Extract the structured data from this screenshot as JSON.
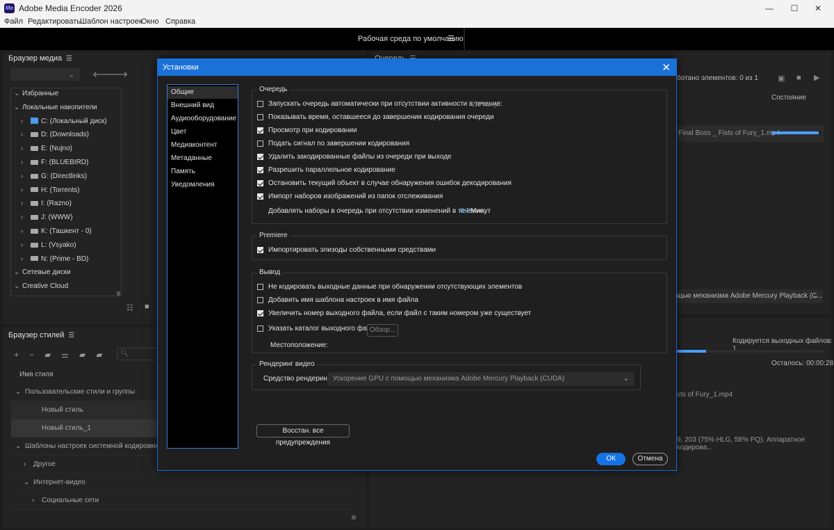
{
  "window": {
    "title": "Adobe Media Encoder 2026",
    "app_icon": "Me",
    "controls": [
      "—",
      "☐",
      "✕"
    ]
  },
  "menu": [
    "Файл",
    "Редактировать",
    "Шаблон настроек",
    "Окно",
    "Справка"
  ],
  "workspace": {
    "label": "Рабочая среда по умолчанию",
    "menu_icon": "☰"
  },
  "media_browser": {
    "title": "Браузер медиа",
    "tree": [
      {
        "label": "Избранные",
        "level": 0,
        "expanded": true,
        "drive": "none"
      },
      {
        "label": "Локальные накопители",
        "level": 0,
        "expanded": true,
        "drive": "none"
      },
      {
        "label": "C: (Локальный диск)",
        "level": 1,
        "expanded": false,
        "drive": "system"
      },
      {
        "label": "D: (Downloads)",
        "level": 1,
        "expanded": false,
        "drive": "disk"
      },
      {
        "label": "E: (Nujno)",
        "level": 1,
        "expanded": false,
        "drive": "disk"
      },
      {
        "label": "F: (BLUEBIRD)",
        "level": 1,
        "expanded": false,
        "drive": "disk"
      },
      {
        "label": "G: (Directlinks)",
        "level": 1,
        "expanded": false,
        "drive": "disk"
      },
      {
        "label": "H: (Torrents)",
        "level": 1,
        "expanded": false,
        "drive": "disk"
      },
      {
        "label": "I: (Razno)",
        "level": 1,
        "expanded": false,
        "drive": "disk"
      },
      {
        "label": "J: (WWW)",
        "level": 1,
        "expanded": false,
        "drive": "disk"
      },
      {
        "label": "K: (Ташкент - 0)",
        "level": 1,
        "expanded": false,
        "drive": "disk"
      },
      {
        "label": "L: (Vsyako)",
        "level": 1,
        "expanded": false,
        "drive": "disk"
      },
      {
        "label": "N: (Prime - BD)",
        "level": 1,
        "expanded": false,
        "drive": "disk"
      },
      {
        "label": "Сетевые диски",
        "level": 0,
        "expanded": true,
        "drive": "none"
      },
      {
        "label": "Creative Cloud",
        "level": 0,
        "expanded": true,
        "drive": "none"
      }
    ]
  },
  "style_browser": {
    "title": "Браузер стилей",
    "column": "Имя стиля",
    "rows": [
      {
        "label": "Пользовательские стили и группы",
        "indent": 0,
        "arrow": "⌄",
        "state": ""
      },
      {
        "label": "Новый стиль",
        "indent": 2,
        "arrow": "",
        "state": "dim"
      },
      {
        "label": "Новый стиль_1",
        "indent": 2,
        "arrow": "",
        "state": "sel"
      },
      {
        "label": "Шаблоны настроек системной кодировки",
        "indent": 0,
        "arrow": "⌄",
        "state": ""
      },
      {
        "label": "Другое",
        "indent": 1,
        "arrow": "›",
        "state": ""
      },
      {
        "label": "Интернет-видео",
        "indent": 1,
        "arrow": "⌄",
        "state": ""
      },
      {
        "label": "Социальные сети",
        "indent": 2,
        "arrow": "›",
        "state": ""
      }
    ]
  },
  "queue": {
    "title": "Очередь",
    "processed": "ботано элементов: 0 из 1",
    "status_col": "Состояние",
    "file": "Final Boss _ Fists of Fury_1.mp4",
    "file_progress": 0.95,
    "renderer_select": "ощью механизма Adobe Mercury Playback (C..."
  },
  "encoding": {
    "outputs": "Кодируется выходных файлов: 1",
    "remaining": "Осталось: 00:00:28",
    "progress": 0.2,
    "file": "sts of Fury_1.mp4",
    "meta": "9, 203 (75% HLG, 58% PQ), Аппаратное кодирова..."
  },
  "dialog": {
    "title": "Установки",
    "close_icon": "✕",
    "nav": [
      {
        "label": "Общие",
        "active": true
      },
      {
        "label": "Внешний вид",
        "active": false
      },
      {
        "label": "Аудиооборудование",
        "active": false
      },
      {
        "label": "Цвет",
        "active": false
      },
      {
        "label": "Медиаконтент",
        "active": false
      },
      {
        "label": "Метаданные",
        "active": false
      },
      {
        "label": "Память",
        "active": false
      },
      {
        "label": "Уведомления",
        "active": false
      }
    ],
    "queue_group": {
      "title": "Очередь",
      "items": [
        {
          "label": "Запускать очередь автоматически при отсутствии активности в течение:",
          "checked": false,
          "suffix": "2,0 Минут"
        },
        {
          "label": "Показывать время, оставшееся до завершения кодирования очереди",
          "checked": false
        },
        {
          "label": "Просмотр при кодировании",
          "checked": true
        },
        {
          "label": "Подать сигнал по завершении кодирования",
          "checked": false
        },
        {
          "label": "Удалить закодированные файлы из очереди при выходе",
          "checked": true
        },
        {
          "label": "Разрешить параллельное кодирование",
          "checked": true
        },
        {
          "label": "Остановить текущий объект в случае обнаружения ошибок декодирования",
          "checked": true
        },
        {
          "label": "Импорт наборов изображений из папок отслеживания",
          "checked": true
        }
      ],
      "sub_label": "Добавлять наборы в очередь при отсутствии изменений в течение:",
      "sub_value": "0,3",
      "sub_unit": "Минут"
    },
    "premiere_group": {
      "title": "Premiere",
      "items": [
        {
          "label": "Импортировать эпизоды собственными средствами",
          "checked": true
        }
      ]
    },
    "output_group": {
      "title": "Вывод",
      "items": [
        {
          "label": "Не кодировать выходные данные при обнаружении отсутствующих элементов",
          "checked": false
        },
        {
          "label": "Добавить имя шаблона настроек в имя файла",
          "checked": false
        },
        {
          "label": "Увеличить номер выходного файла, если файл с таким номером уже существует",
          "checked": true
        },
        {
          "label": "Указать каталог выходного файла:",
          "checked": false
        }
      ],
      "browse_label": "Обзор...",
      "location_label": "Местоположение:"
    },
    "render_group": {
      "title": "Рендеринг видео",
      "label": "Средство рендеринга:",
      "value": "Ускорение GPU с помощью механизма Adobe Mercury Playback (CUDA)"
    },
    "reset_warnings": "Восстан. все предупреждения",
    "ok": "ОК",
    "cancel": "Отмена"
  },
  "colors": {
    "accent": "#1473e6",
    "dialog_border": "#1a6bd0"
  }
}
